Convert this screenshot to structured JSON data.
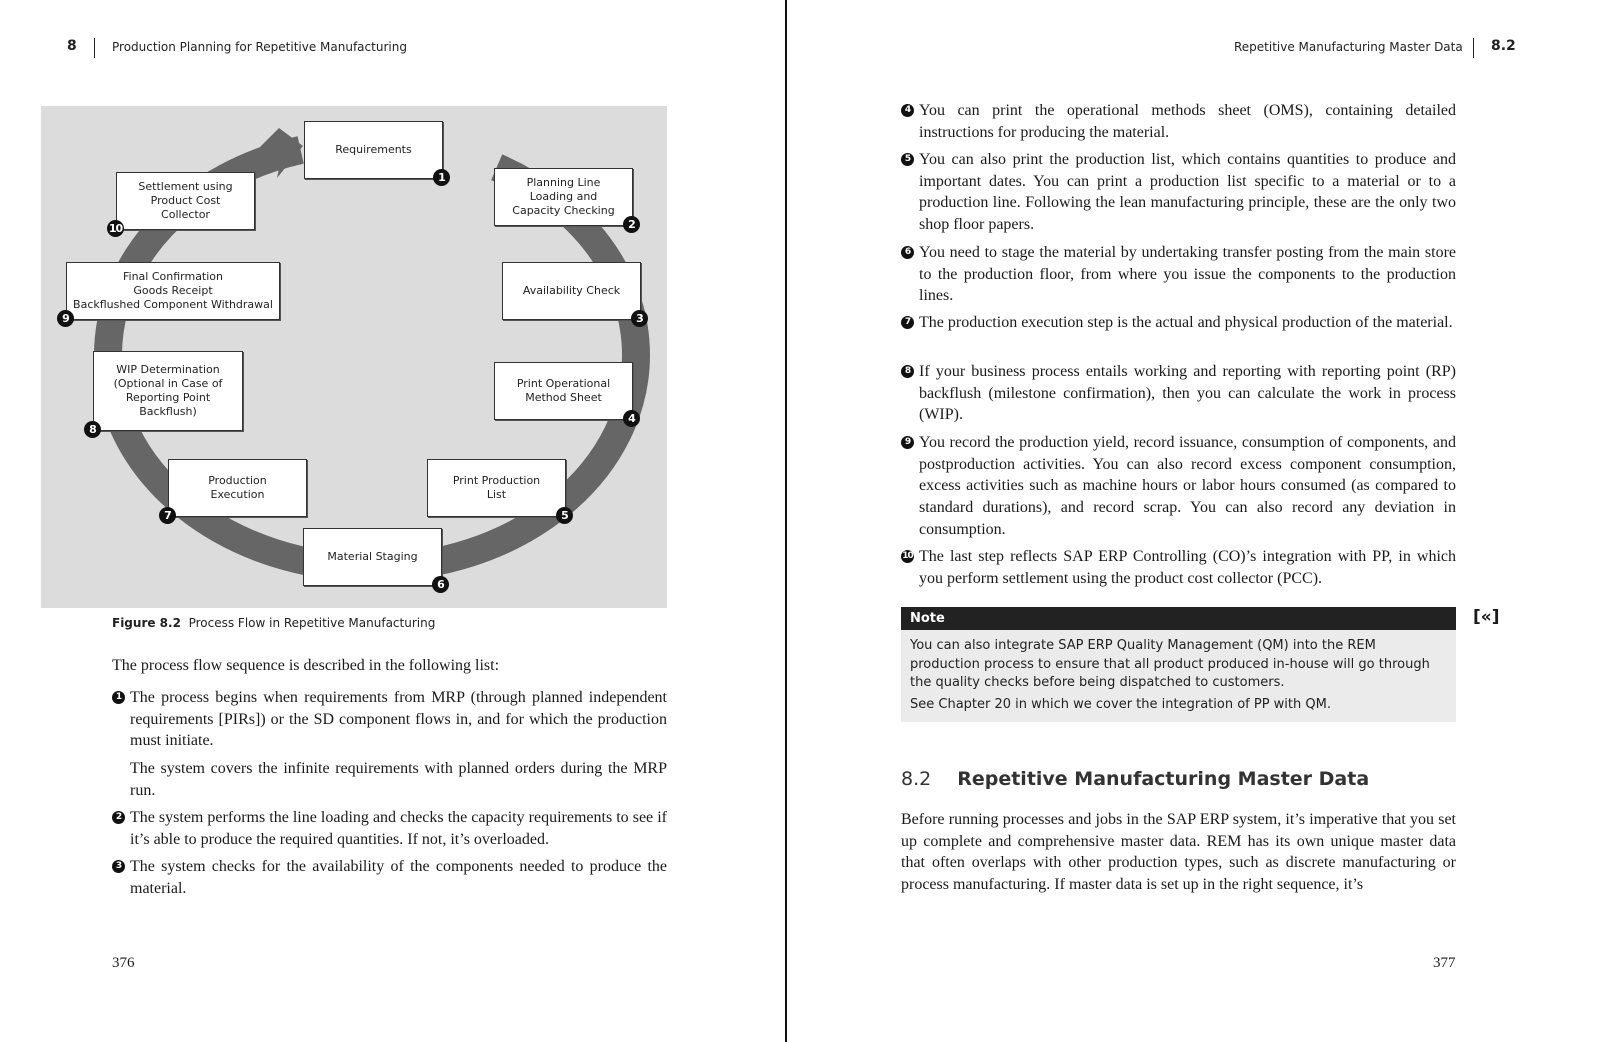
{
  "left_page": {
    "header": {
      "chapter_number": "8",
      "chapter_title": "Production Planning for Repetitive Manufacturing"
    },
    "figure": {
      "steps": [
        {
          "number": "1",
          "label": "Requirements"
        },
        {
          "number": "2",
          "label": "Planning Line\nLoading and\nCapacity Checking"
        },
        {
          "number": "3",
          "label": "Availability Check"
        },
        {
          "number": "4",
          "label": "Print Operational\nMethod Sheet"
        },
        {
          "number": "5",
          "label": "Print Production\nList"
        },
        {
          "number": "6",
          "label": "Material Staging"
        },
        {
          "number": "7",
          "label": "Production\nExecution"
        },
        {
          "number": "8",
          "label": "WIP Determination\n(Optional in Case of\nReporting Point\nBackflush)"
        },
        {
          "number": "9",
          "label": "Final Confirmation\nGoods Receipt\nBackflushed Component Withdrawal"
        },
        {
          "number": "10",
          "label": "Settlement using\nProduct Cost\nCollector"
        }
      ],
      "caption_label": "Figure 8.2",
      "caption_text": "Process Flow in Repetitive Manufacturing"
    },
    "intro": "The process flow sequence is described in the following list:",
    "items": [
      {
        "number": "1",
        "text": "The process begins when requirements from MRP (through planned independent requirements [PIRs]) or the SD component flows in, and for which the production must initiate."
      },
      {
        "number": "",
        "text": "The system covers the infinite requirements with planned orders during the MRP run."
      },
      {
        "number": "2",
        "text": "The system performs the line loading and checks the capacity requirements to see if it’s able to produce the required quantities. If not, it’s overloaded."
      },
      {
        "number": "3",
        "text": "The system checks for the availability of the components needed to produce the material."
      }
    ],
    "page_number": "376"
  },
  "right_page": {
    "header": {
      "section_title": "Repetitive Manufacturing Master Data",
      "section_number": "8.2"
    },
    "items": [
      {
        "number": "4",
        "text": "You can print the operational methods sheet (OMS), containing detailed instructions for producing the material."
      },
      {
        "number": "5",
        "text": "You can also print the production list, which contains quantities to produce and important dates. You can print a production list specific to a material or to a production line. Following the lean manufacturing principle, these are the only two shop floor papers."
      },
      {
        "number": "6",
        "text": "You need to stage the material by undertaking transfer posting from the main store to the production floor, from where you issue the components to the production lines."
      },
      {
        "number": "7",
        "text": "The production execution step is the actual and physical production of the material."
      },
      {
        "number": "8",
        "text": "If your business process entails working and reporting with reporting point (RP) backflush (milestone confirmation), then you can calculate the work in process (WIP)."
      },
      {
        "number": "9",
        "text": "You record the production yield, record issuance, consumption of components, and postproduction activities. You can also record excess component consumption, excess activities such as machine hours or labor hours consumed (as compared to standard durations), and record scrap. You can also record any deviation in consumption."
      },
      {
        "number": "10",
        "text": "The last step reflects SAP ERP Controlling (CO)’s integration with PP, in which you perform settlement using the product cost collector (PCC)."
      }
    ],
    "note": {
      "title": "Note",
      "margin_icon": "[«]",
      "paragraphs": [
        "You can also integrate SAP ERP Quality Management (QM) into the REM production process to ensure that all product produced in-house will go through the quality checks before being dispatched to customers.",
        "See Chapter 20 in which we cover the integration of PP with QM."
      ]
    },
    "section": {
      "number": "8.2",
      "title": "Repetitive Manufacturing Master Data"
    },
    "body": "Before running processes and jobs in the SAP ERP system, it’s imperative that you set up complete and comprehensive master data. REM has its own unique master data that often overlaps with other production types, such as discrete manufacturing or process manufacturing. If master data is set up in the right sequence, it’s",
    "page_number": "377"
  },
  "colors": {
    "figure_bg": "#dcdcdc",
    "ring": "#666666",
    "note_header": "#222222",
    "note_body": "#ebebeb"
  }
}
